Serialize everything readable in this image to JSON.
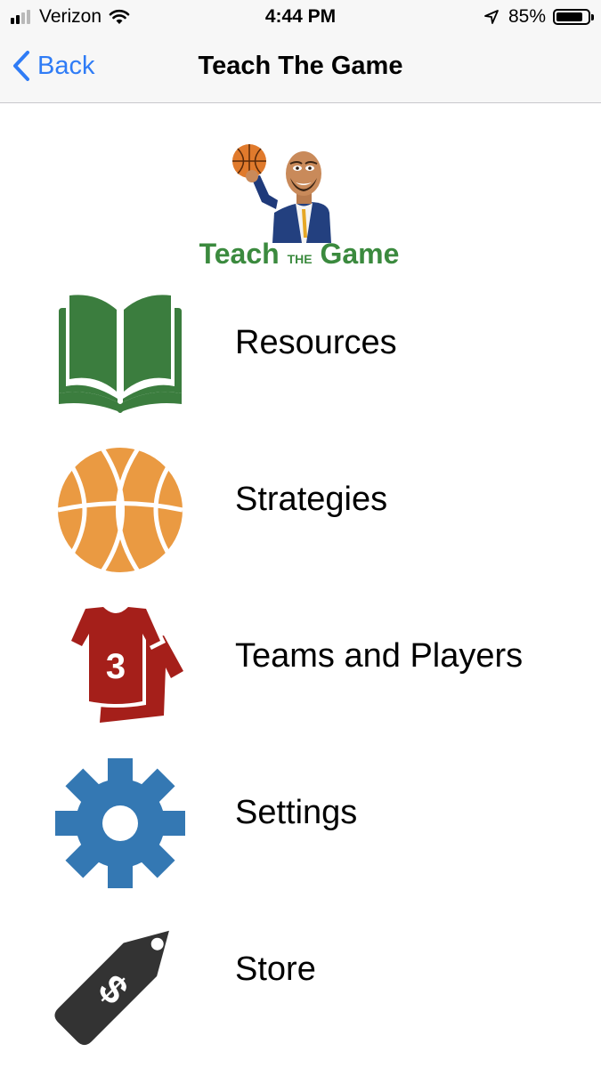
{
  "status_bar": {
    "carrier": "Verizon",
    "time": "4:44 PM",
    "battery_percent": "85%",
    "battery_level": 0.85,
    "signal_bars": 2,
    "signal_bars_total": 4
  },
  "nav": {
    "back_label": "Back",
    "title": "Teach The Game"
  },
  "logo": {
    "word_1": "Teach",
    "word_2": "THE",
    "word_3": "Game"
  },
  "menu": [
    {
      "label": "Resources",
      "icon": "book-icon",
      "color": "#3b7d3e"
    },
    {
      "label": "Strategies",
      "icon": "basketball-icon",
      "color": "#ea9a42"
    },
    {
      "label": "Teams and Players",
      "icon": "jersey-icon",
      "color": "#a51f1a",
      "jersey_number": "3"
    },
    {
      "label": "Settings",
      "icon": "gear-icon",
      "color": "#3478b3"
    },
    {
      "label": "Store",
      "icon": "price-tag-icon",
      "color": "#333333"
    }
  ],
  "colors": {
    "accent": "#2f7cf6",
    "logo_green": "#3b8a3e"
  }
}
